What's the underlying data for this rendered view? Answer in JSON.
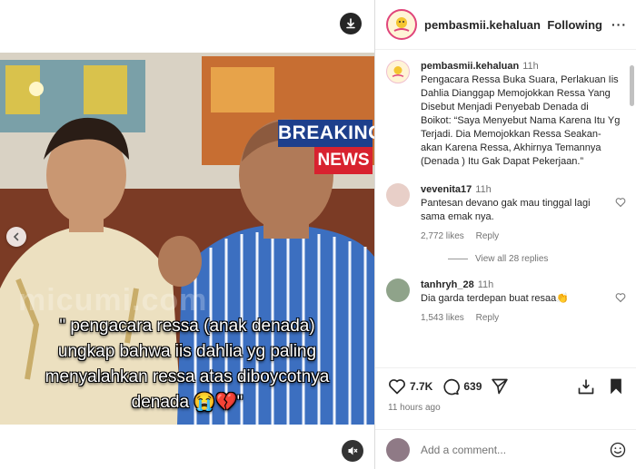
{
  "post": {
    "author": "pembasmii.kehaluan",
    "follow_label": "Following",
    "more_label": "···"
  },
  "media": {
    "breaking_line1": "BREAKING",
    "breaking_line2": "NEWS",
    "watermark": "micumi.com",
    "caption_lines": [
      "\" pengacara ressa (anak denada)",
      "ungkap bahwa iis dahlia yg paling",
      "menyalahkan ressa atas diboycotnya",
      "denada 😭💔\""
    ]
  },
  "caption_comment": {
    "username": "pembasmii.kehaluan",
    "time": "11h",
    "text": "Pengacara Ressa Buka Suara, Perlakuan Iis Dahlia Dianggap Memojokkan Ressa Yang Disebut Menjadi Penyebab Denada di Boikot: “Saya Menyebut Nama Karena Itu Yg Terjadi. Dia Memojokkan Ressa Seakan-akan Karena Ressa, Akhirnya Temannya (Denada ) Itu Gak Dapat Pekerjaan.”"
  },
  "comments": [
    {
      "username": "vevenita17",
      "time": "11h",
      "text": "Pantesan devano gak mau tinggal lagi sama emak nya.",
      "likes": "2,772 likes",
      "reply_label": "Reply",
      "view_replies": "View all 28 replies"
    },
    {
      "username": "tanhryh_28",
      "time": "11h",
      "text": "Dia garda terdepan buat resaa👏",
      "likes": "1,543 likes",
      "reply_label": "Reply"
    }
  ],
  "actions": {
    "like_count": "7.7K",
    "comment_count": "639",
    "posted": "11 hours ago"
  },
  "add_comment": {
    "placeholder": "Add a comment..."
  },
  "colors": {
    "accent_pink": "#e0457b",
    "breaking_blue": "#1d3f8c",
    "breaking_red": "#d8222f"
  },
  "icons": [
    "download-icon",
    "mute-icon",
    "chevron-left-icon",
    "heart-icon",
    "comment-icon",
    "share-icon",
    "add-to-post-icon",
    "bookmark-icon",
    "emoji-icon"
  ]
}
